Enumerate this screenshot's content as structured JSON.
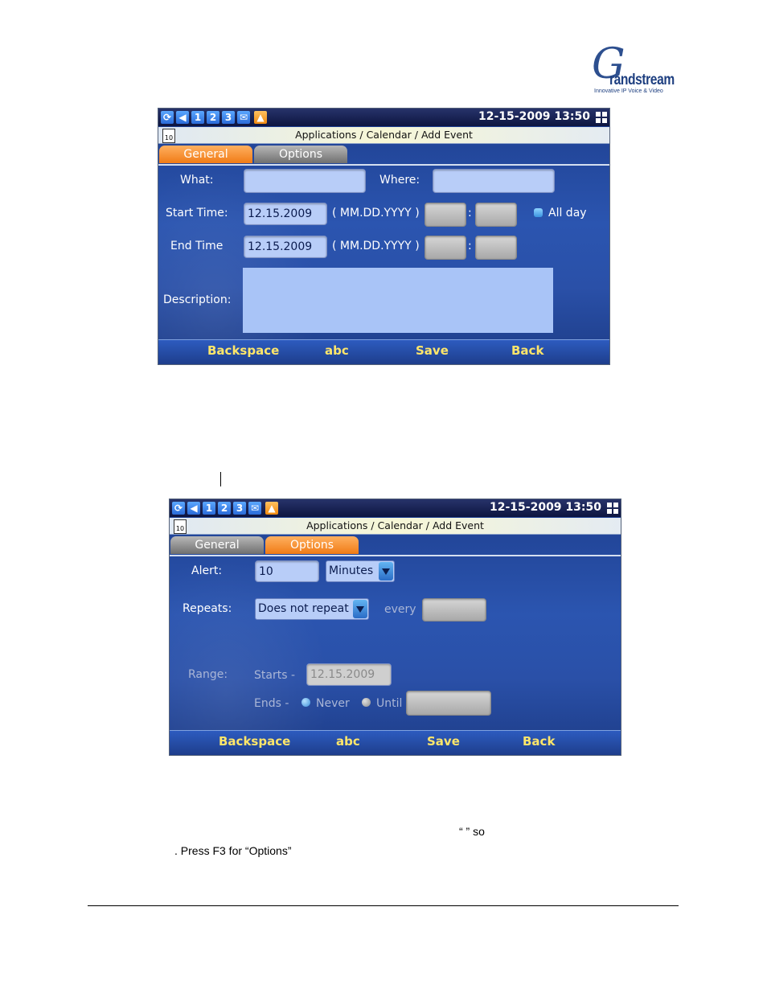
{
  "brand": {
    "logo_letter": "G",
    "logo_word": "randstream",
    "logo_tagline": "Innovative IP Voice & Video"
  },
  "status": {
    "icons": [
      "refresh-icon",
      "volume-icon",
      "line-1",
      "line-2",
      "line-3",
      "email-icon",
      "alert-icon"
    ],
    "line_labels": [
      "1",
      "2",
      "3"
    ],
    "datetime": "12-15-2009 13:50"
  },
  "screen1": {
    "title": "Applications / Calendar / Add Event",
    "cal_icon": "10",
    "tabs": [
      "General",
      "Options"
    ],
    "what_label": "What:",
    "where_label": "Where:",
    "start_label": "Start Time:",
    "start_date": "12.15.2009",
    "date_format": "( MM.DD.YYYY )",
    "time_sep": ":",
    "allday_label": "All day",
    "end_label": "End Time",
    "end_date": "12.15.2009",
    "description_label": "Description:"
  },
  "screen2": {
    "title": "Applications / Calendar / Add Event",
    "cal_icon": "10",
    "tabs": [
      "General",
      "Options"
    ],
    "alert_label": "Alert:",
    "alert_value": "10",
    "alert_unit": "Minutes",
    "repeats_label": "Repeats:",
    "repeats_value": "Does not repeat",
    "every_label": "every",
    "range_label": "Range:",
    "starts_label": "Starts -",
    "starts_value": "12.15.2009",
    "ends_label": "Ends -",
    "never_label": "Never",
    "until_label": "Until"
  },
  "softkeys": [
    "Backspace",
    "abc",
    "Save",
    "Back"
  ],
  "captions": {
    "quote_fragment": "“      ” so",
    "press_line": ".  Press  F3  for  “Options”"
  },
  "colors": {
    "accent_tab": "#f07b16",
    "softkey_text": "#ffe66a",
    "screen_bg": "#2b55b0"
  }
}
